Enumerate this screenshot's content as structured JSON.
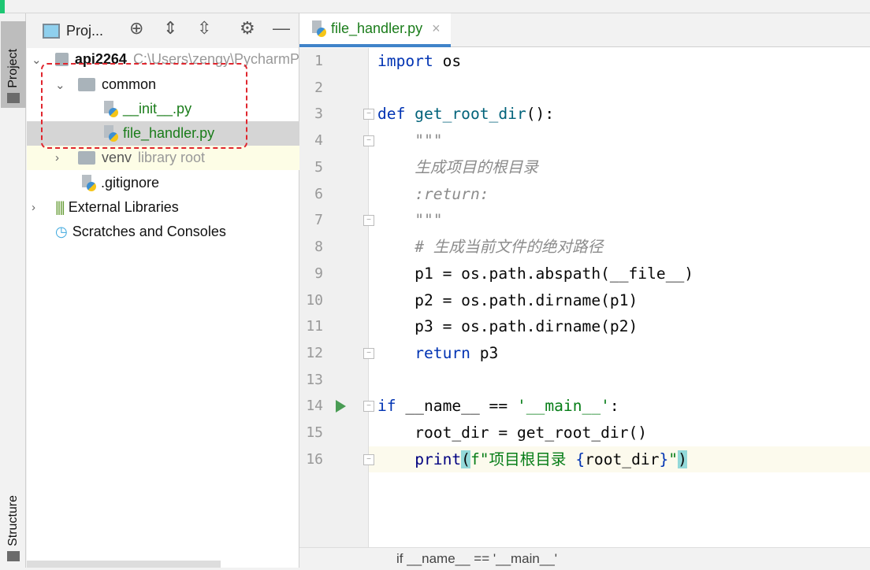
{
  "sidebar_strip": {
    "project_tab": "Project",
    "structure_tab": "Structure"
  },
  "project_panel": {
    "title": "Proj...",
    "toolbar_icons": [
      "locate-icon",
      "expand-all-icon",
      "collapse-all-icon",
      "gear-icon",
      "minimize-icon"
    ],
    "tree": [
      {
        "label": "api2264",
        "hint": "C:\\Users\\zengy\\PycharmP"
      },
      {
        "label": "common"
      },
      {
        "label": "__init__.py"
      },
      {
        "label": "file_handler.py",
        "selected": true
      },
      {
        "label": "venv",
        "hint": "library root"
      },
      {
        "label": ".gitignore"
      },
      {
        "label": "External Libraries"
      },
      {
        "label": "Scratches and Consoles"
      }
    ]
  },
  "editor": {
    "tab": {
      "label": "file_handler.py",
      "close": "×"
    },
    "current_line": 16,
    "lines": [
      {
        "n": "1",
        "t": [
          [
            "import",
            "kw"
          ],
          [
            " os",
            ""
          ]
        ]
      },
      {
        "n": "2",
        "t": []
      },
      {
        "n": "3",
        "t": [
          [
            "def",
            "kw"
          ],
          [
            " get_root_dir",
            "fn"
          ],
          [
            "():",
            ""
          ]
        ]
      },
      {
        "n": "4",
        "t": [
          [
            "    ",
            ""
          ],
          [
            "\"\"\"",
            "doc"
          ]
        ]
      },
      {
        "n": "5",
        "t": [
          [
            "    ",
            ""
          ],
          [
            "生成项目的根目录",
            "doc"
          ]
        ]
      },
      {
        "n": "6",
        "t": [
          [
            "    ",
            ""
          ],
          [
            ":return:",
            "doc"
          ]
        ]
      },
      {
        "n": "7",
        "t": [
          [
            "    ",
            ""
          ],
          [
            "\"\"\"",
            "doc"
          ]
        ]
      },
      {
        "n": "8",
        "t": [
          [
            "    ",
            ""
          ],
          [
            "# 生成当前文件的绝对路径",
            "cm"
          ]
        ]
      },
      {
        "n": "9",
        "t": [
          [
            "    p1 = os.path.abspath(__file__)",
            ""
          ]
        ]
      },
      {
        "n": "10",
        "t": [
          [
            "    p2 = os.path.dirname(p1)",
            ""
          ]
        ]
      },
      {
        "n": "11",
        "t": [
          [
            "    p3 = os.path.dirname(p2)",
            ""
          ]
        ]
      },
      {
        "n": "12",
        "t": [
          [
            "    ",
            ""
          ],
          [
            "return",
            "kw"
          ],
          [
            " p3",
            ""
          ]
        ]
      },
      {
        "n": "13",
        "t": []
      },
      {
        "n": "14",
        "t": [
          [
            "if",
            "kw"
          ],
          [
            " __name__ == ",
            ""
          ],
          [
            "'__main__'",
            "str"
          ],
          [
            ":",
            ""
          ]
        ]
      },
      {
        "n": "15",
        "t": [
          [
            "    root_dir = get_root_dir()",
            ""
          ]
        ]
      },
      {
        "n": "16",
        "t": [
          [
            "    ",
            ""
          ],
          [
            "print",
            "blt"
          ],
          [
            "(",
            "bm"
          ],
          [
            "f\"项目根目录 ",
            "str"
          ],
          [
            "{",
            "kw"
          ],
          [
            "root_dir",
            ""
          ],
          [
            "}",
            "kw"
          ],
          [
            "\"",
            "str"
          ],
          [
            ")",
            "bm"
          ]
        ]
      }
    ],
    "breadcrumb": "if __name__ == '__main__'"
  }
}
